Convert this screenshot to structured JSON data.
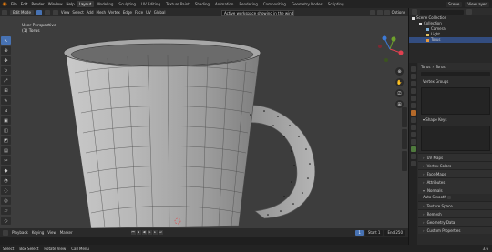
{
  "topbar": {
    "menus": [
      "File",
      "Edit",
      "Render",
      "Window",
      "Help"
    ],
    "workspaces": [
      "Layout",
      "Modeling",
      "Sculpting",
      "UV Editing",
      "Texture Paint",
      "Shading",
      "Animation",
      "Rendering",
      "Compositing",
      "Geometry Nodes",
      "Scripting"
    ],
    "active_workspace": "Layout",
    "scene": "Scene",
    "view_layer": "ViewLayer"
  },
  "viewport_header": {
    "mode": "Edit Mode",
    "items": [
      "View",
      "Select",
      "Add",
      "Mesh",
      "Vertex",
      "Edge",
      "Face",
      "UV"
    ],
    "transform": "Global",
    "options": "Options"
  },
  "tooltip": "Active workspace showing in the window.",
  "viewport": {
    "perspective": "User Perspective",
    "object": "(1) Torus"
  },
  "timeline": {
    "menus": [
      "Playback",
      "Keying",
      "View",
      "Marker"
    ],
    "current_frame": "1",
    "start_label": "Start",
    "start": "1",
    "end_label": "End",
    "end": "250"
  },
  "statusbar": {
    "select": "Select",
    "box_select": "Box Select",
    "rotate": "Rotate View",
    "call_menu": "Call Menu",
    "version": "3.6"
  },
  "outliner": {
    "scene_collection": "Scene Collection",
    "collection": "Collection",
    "camera": "Camera",
    "light": "Light",
    "torus": "Torus"
  },
  "properties": {
    "object": "Torus",
    "mesh": "Torus",
    "panels": [
      "Vertex Groups",
      "Shape Keys",
      "UV Maps",
      "Vertex Colors",
      "Face Maps",
      "Attributes",
      "Normals",
      "Auto Smooth",
      "Texture Space",
      "Remesh",
      "Geometry Data",
      "Custom Properties"
    ],
    "vertex_groups_header": "Vertex Groups",
    "shape_keys_header": "Shape Keys"
  },
  "colors": {
    "accent": "#4772b3",
    "viewport_bg": "#3d3d3d",
    "logo": "#e87d0d"
  }
}
